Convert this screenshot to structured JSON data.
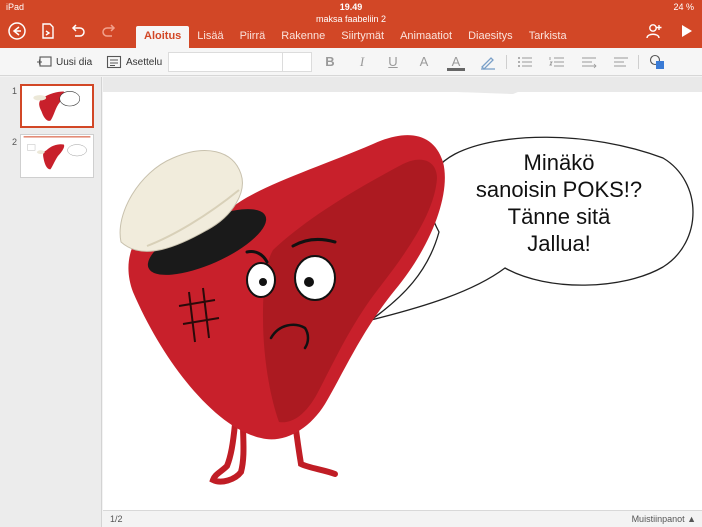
{
  "status": {
    "device": "iPad",
    "time": "19.49",
    "battery": "24 %"
  },
  "document": {
    "title": "maksa faabeliin 2"
  },
  "tabs": [
    {
      "label": "Aloitus",
      "active": true
    },
    {
      "label": "Lisää"
    },
    {
      "label": "Piirrä"
    },
    {
      "label": "Rakenne"
    },
    {
      "label": "Siirtymät"
    },
    {
      "label": "Animaatiot"
    },
    {
      "label": "Diaesitys"
    },
    {
      "label": "Tarkista"
    }
  ],
  "toolbar": {
    "new_slide": "Uusi dia",
    "layout": "Asettelu"
  },
  "formatting": {
    "bold": "B",
    "italic": "I",
    "underline": "U",
    "more": "A",
    "font_color": "A"
  },
  "thumbnails": [
    {
      "number": "1",
      "selected": true
    },
    {
      "number": "2",
      "selected": false
    }
  ],
  "slide": {
    "bubble_lines": [
      "Minäkö",
      "sanoisin POKS!?",
      "Tänne sitä",
      "Jallua!"
    ]
  },
  "footer": {
    "slide_count": "1/2",
    "notes": "Muistiinpanot ▲"
  },
  "colors": {
    "accent": "#d24726",
    "liver": "#c8202b"
  }
}
